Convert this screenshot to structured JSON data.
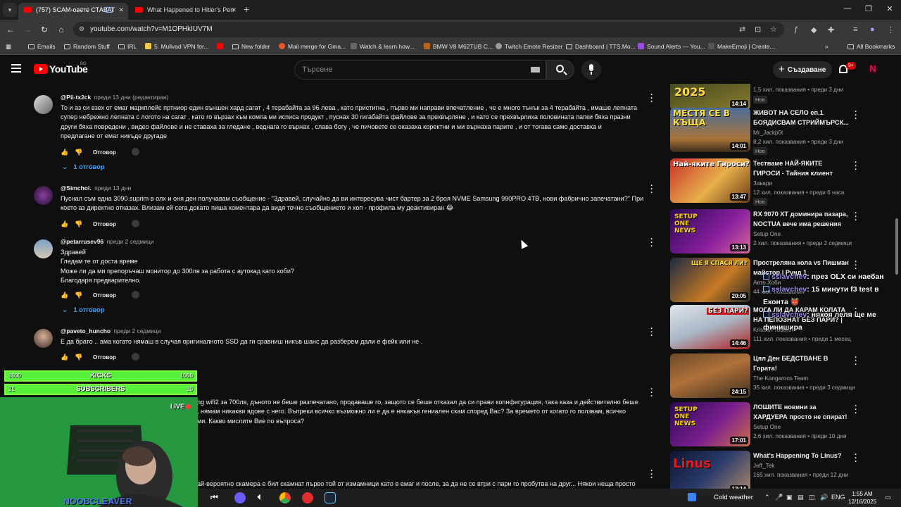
{
  "browser": {
    "tabs": [
      {
        "title": "(757) SCAM-овете СТАВАТ"
      },
      {
        "title": "What Happened to Hitler's Pen"
      }
    ],
    "url": "youtube.com/watch?v=M1OPHkIUV7M",
    "bookmarks": [
      "Emails",
      "Random Stuff",
      "IRL",
      "5. Mullvad VPN for...",
      "New folder",
      "Mail merge for Gma...",
      "Watch & learn how...",
      "BMW V8 M62TUB C...",
      "Twitch Emote Resizer",
      "Dashboard | TTS.Mo...",
      "Sound Alerts — You...",
      "MakeEmoji | Create...",
      "All Bookmarks"
    ],
    "brand_colors": {
      "youtube_red": "#ff0000",
      "link_blue": "#3ea6ff",
      "overlay_green": "#56f03a"
    }
  },
  "youtube": {
    "logo_text": "YouTube",
    "country_code": "BG",
    "search_placeholder": "Търсене",
    "create_label": "Създаване",
    "notifications_badge": "9+",
    "avatar_letter": "N"
  },
  "comments": [
    {
      "user": "@Pii-tx2ck",
      "time": "преди 13 дни (редактиран)",
      "lines": [
        "То и аз си взех от емаг маркплейс пртниор един външен хард сагат , 4 терабайта за 96 лева , като пристигна , първо ми направи впечатление , че е много тънък за 4 терабайта , имаше лепната",
        "супер небрежно лепната с логото на сагат , като го вързах към компа ми исписа продукт , пуснах 30 гигабайта файлове за прехвърляне , и като се прехвърлиха половината папки бяха празни",
        "други бяха повредени , видео файлове и не ставаха за гледане , веднага го върнах , слава богу , че пичовете се оказаха коректни и ми върнаха парите , и от тогава само доставка и",
        "предлагане от емаг никъде другаде"
      ],
      "reply_label": "Отговор",
      "replies": "1 отговор"
    },
    {
      "user": "@Simchol.",
      "time": "преди 13 дни",
      "lines": [
        "Пуснал съм една 3090 suprim в олх и оня ден получавам съобщение - \"Здравей, случайно да ви интересува чист бартер за 2 броя NVME Samsung 990PRO 4TB, нови фабрично запечатани?\" При",
        "което аз директно отказах. Влизам ей сега докато пиша коментара да видя точно съобщението и хоп - профила му деактивиран 😂"
      ],
      "reply_label": "Отговор",
      "replies": ""
    },
    {
      "user": "@petarrusev96",
      "time": "преди 2 седмици",
      "lines": [
        "Здравей",
        "Гледам те от доста време",
        "Може ли да ми препоръчаш монитор до 300лв за работа с аутокад като хоби?",
        "Благодаря предварително."
      ],
      "reply_label": "Отговор",
      "replies": "1 отговор"
    },
    {
      "user": "@paveto_huncho",
      "time": "преди 2 седмици",
      "lines": [
        "Е да брато .. ама когато нямаш в случая оригиналното SSD да ги сравниш никъв шанс да разберем дали е фейк или не ."
      ],
      "reply_label": "Отговор",
      "replies": ""
    },
    {
      "user": "",
      "time": "",
      "lines": [
        "ng wifi2 за 700лв, дъното не беше разпечатано, продаваше го, защото се беше отказал да си прави копнфигурация, така каза и действително беше",
        ", нямам никакви ядове с него. Въпреки всичко възможно ли е да е някакъв гениален скам според Вас? За времето от когато го ползвам, всичко",
        "ми. Какво мислите Вие по въпроса?"
      ],
      "reply_label": "",
      "replies": ""
    },
    {
      "user": "",
      "time": "",
      "lines": [
        "ай-вероятно скамера е бил скамнат първо той от измамници като в емаг и после, за да не се втри с пари го пробутва на друг... Някои неща просто"
      ],
      "reply_label": "",
      "replies": ""
    }
  ],
  "sidebar": [
    {
      "title": "",
      "channel": "",
      "meta": "1,5 хил. показвания • преди 3 дни",
      "duration": "14:14",
      "badge": "Нов",
      "thumb_text": "2025"
    },
    {
      "title": "ЖИВОТ НА СЕЛО еп.1 БОЯДИСВАМ СТРИЙМЪРСК...",
      "channel": "Mr_Jackp0t",
      "meta": "8,2 хил. показвания • преди 3 дни",
      "duration": "14:01",
      "badge": "Нов",
      "thumb_text": "МЕСТЯ СЕ В КЪЩА"
    },
    {
      "title": "Тестваме НАЙ-ЯКИТЕ ГИРОСИ - Тайния клиент",
      "channel": "Закари",
      "meta": "12 хил. показвания • преди 6 часа",
      "duration": "13:47",
      "badge": "Нов",
      "thumb_text": "Най-яките Гироси?"
    },
    {
      "title": "RX 9070 XT доминира пазара, NOCTUA вече има решения з...",
      "channel": "Setup One",
      "meta": "2 хил. показвания • преди 2 седмици",
      "duration": "13:13",
      "badge": "",
      "thumb_text": "SETUP ONE NEWS"
    },
    {
      "title": "Простреляна кола vs Пишман майстор | Рунд 1",
      "channel": "Авто Хоби",
      "meta": "44 хил. показвания",
      "duration": "20:05",
      "badge": "",
      "thumb_text": "ЩЕ Я СПАСЯ ЛИ?"
    },
    {
      "title": "МОГА ЛИ ДА КАРАМ КОЛАТА НА ПЕПОЗНАТ БЕЗ ПАРИ? | ...",
      "channel": "Kristian Todorov",
      "meta": "111 хил. показвания • преди 1 месец",
      "duration": "14:46",
      "badge": "",
      "thumb_text": "БЕЗ ПАРИ?"
    },
    {
      "title": "Цял Ден БЕДСТВАНЕ В Гората!",
      "channel": "The Kangaroos Team",
      "meta": "35 хил. показвания • преди 3 седмици",
      "duration": "24:15",
      "badge": "",
      "thumb_text": ""
    },
    {
      "title": "ЛОШИТЕ новини за ХАРДУЕРА просто не спират!",
      "channel": "Setup One",
      "meta": "2,6 хил. показвания • преди 10 дни",
      "duration": "17:01",
      "badge": "",
      "thumb_text": "SETUP ONE NEWS"
    },
    {
      "title": "What's Happening To Linus?",
      "channel": "Jeff_Tek",
      "meta": "165 хил. показвания • преди 12 дни",
      "duration": "13:14",
      "badge": "",
      "thumb_text": "Linus"
    }
  ],
  "overlay": {
    "chat": [
      {
        "user": "sslavchev",
        "text": ": през OLX си наебан"
      },
      {
        "user": "sslavchev",
        "text": ": 15 минути f3 test в Еконта 👹"
      },
      {
        "user": "sslavchev",
        "text": ": някоя леля ще ме финишира"
      }
    ],
    "kicks": {
      "label": "KICKS",
      "left": "1000",
      "right": "1000",
      "fill": 1.0
    },
    "subs": {
      "label": "SUBSCRIBERS",
      "left": "21",
      "right": "10",
      "fill": 1.0
    },
    "live_label": "LIVE",
    "cam_name": "NOOBCLEAVER"
  },
  "taskbar": {
    "weather": "Cold weather",
    "lang": "ENG",
    "time": "1:55 AM",
    "date": "12/16/2025"
  }
}
